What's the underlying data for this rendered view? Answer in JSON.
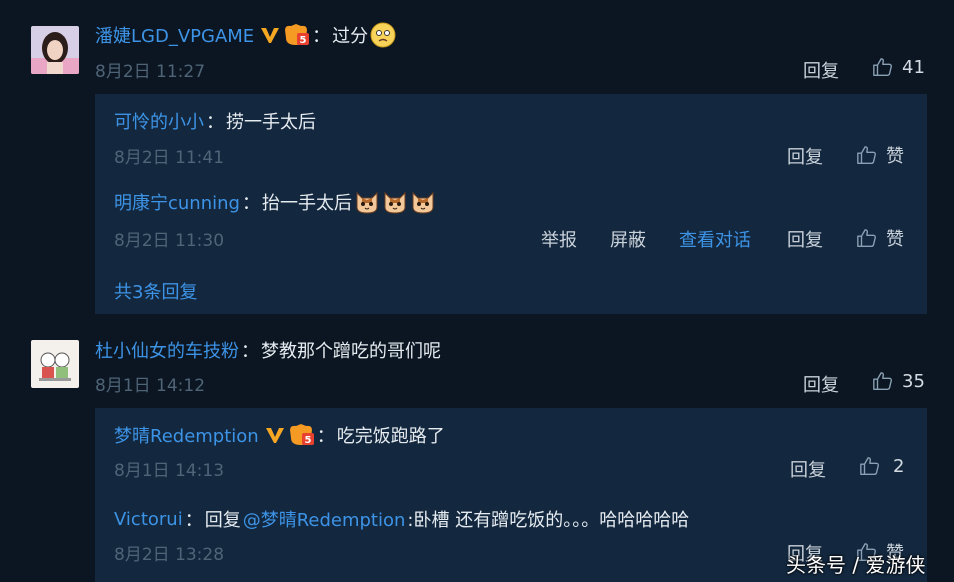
{
  "comments": [
    {
      "username": "潘婕LGD_VPGAME",
      "sep": "：",
      "text": "过分",
      "time": "8月2日 11:27",
      "reply_label": "回复",
      "likes": "41",
      "replies": [
        {
          "username": "可怜的小小",
          "sep": "：",
          "text": "捞一手太后",
          "time": "8月2日 11:41",
          "reply_label": "回复",
          "like_label": "赞"
        },
        {
          "username": "明康宁cunning",
          "sep": "：",
          "text": "抬一手太后",
          "time": "8月2日 11:30",
          "report_label": "举报",
          "block_label": "屏蔽",
          "view_label": "查看对话",
          "reply_label": "回复",
          "like_label": "赞"
        }
      ],
      "more_replies": "共3条回复"
    },
    {
      "username": "杜小仙女的车技粉",
      "sep": "：",
      "text": "梦教那个蹭吃的哥们呢",
      "time": "8月1日 14:12",
      "reply_label": "回复",
      "likes": "35",
      "replies": [
        {
          "username": "梦晴Redemption",
          "sep": "：",
          "text": "吃完饭跑路了",
          "time": "8月1日 14:13",
          "reply_label": "回复",
          "likes": "2"
        },
        {
          "username": "Victorui",
          "sep": "：",
          "prefix": "回复",
          "mention": "@梦晴Redemption",
          "text": ":卧槽 还有蹭吃饭的。。。哈哈哈哈哈",
          "time": "8月2日 13:28",
          "reply_label": "回复",
          "like_label": "赞"
        }
      ]
    }
  ],
  "watermark": "头条号 / 爱游侠",
  "colors": {
    "accent": "#3d93e6",
    "background": "#0b1622",
    "reply_bg": "#13283f"
  }
}
